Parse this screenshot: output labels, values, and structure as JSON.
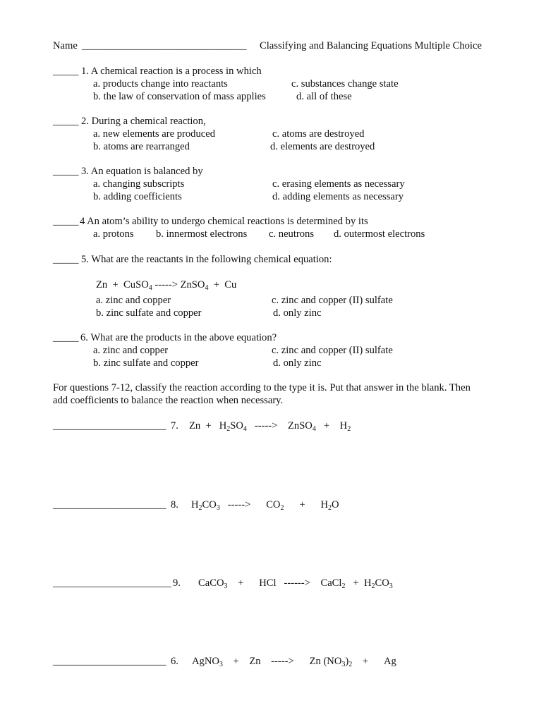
{
  "header": {
    "name_label": "Name",
    "name_blank": "________________________________",
    "title": "Classifying and Balancing Equations Multiple Choice"
  },
  "questions": [
    {
      "blank": "_____",
      "stem": "1.  A chemical reaction is a process in which",
      "a": "a.  products change into reactants",
      "b": "b.  the law of conservation of mass applies",
      "c": "c.  substances change state",
      "d": "d.  all of these"
    },
    {
      "blank": "_____",
      "stem": "2.  During a chemical reaction,",
      "a": "a.  new elements are produced",
      "b": "b.  atoms are rearranged",
      "c": "c.  atoms are destroyed",
      "d": "d.  elements are destroyed"
    },
    {
      "blank": "_____",
      "stem": "3.  An equation is balanced by",
      "a": "a.  changing subscripts",
      "b": "b.  adding coefficients",
      "c": "c.  erasing elements as necessary",
      "d": "d.  adding elements as necessary"
    },
    {
      "blank": "_____",
      "stem": "4  An atom’s ability to undergo chemical reactions is determined by its",
      "a": "a.  protons",
      "b": "b.  innermost electrons",
      "c": "c.  neutrons",
      "d": "d.  outermost electrons"
    },
    {
      "blank": "_____",
      "stem": "5.  What are the reactants in the following chemical equation:",
      "equation": {
        "r1": "Zn",
        "plus1": "+",
        "r2": "CuSO",
        "r2_sub": "4",
        "arrow": "----->",
        "p1": "ZnSO",
        "p1_sub": "4",
        "plus2": "+",
        "p2": "Cu"
      },
      "a": "a.  zinc and copper",
      "b": "b.  zinc sulfate and copper",
      "c": "c.  zinc and copper (II) sulfate",
      "d": "d.  only zinc"
    },
    {
      "blank": "_____",
      "stem": "6.  What are the products in the above equation?",
      "a": "a.  zinc and copper",
      "b": "b.  zinc sulfate and copper",
      "c": "c.  zinc and copper (II) sulfate",
      "d": "d.  only zinc"
    }
  ],
  "instructions": {
    "line1": "For questions 7-12,  classify the reaction according to the type it is. Put that answer in the blank.  Then",
    "line2": "add coefficients to balance the reaction when necessary."
  },
  "reactions": [
    {
      "blank": "______________________",
      "number": "7.",
      "parts": {
        "t1": "Zn",
        "plus1": "+",
        "t2a": "H",
        "t2a_sub": "2",
        "t2b": "SO",
        "t2b_sub": "4",
        "arrow": "----->",
        "t3": "ZnSO",
        "t3_sub": "4",
        "plus2": "+",
        "t4": "H",
        "t4_sub": "2"
      }
    },
    {
      "blank": "______________________",
      "number": "8.",
      "parts": {
        "t1a": "H",
        "t1a_sub": "2",
        "t1b": "CO",
        "t1b_sub": "3",
        "arrow": "----->",
        "t2": "CO",
        "t2_sub": "2",
        "plus1": "+",
        "t3a": "H",
        "t3a_sub": "2",
        "t3b": "O"
      }
    },
    {
      "blank": "_______________________",
      "number": "9.",
      "parts": {
        "t1": "CaCO",
        "t1_sub": "3",
        "plus1": "+",
        "t2": "HCl",
        "arrow": "------>",
        "t3": "CaCl",
        "t3_sub": "2",
        "plus2": "+",
        "t4a": "H",
        "t4a_sub": "2",
        "t4b": "CO",
        "t4b_sub": "3"
      }
    },
    {
      "blank": "______________________",
      "number": "6.",
      "parts": {
        "t1": "AgNO",
        "t1_sub": "3",
        "plus1": "+",
        "t2": "Zn",
        "arrow": "----->",
        "t3a": "Zn (NO",
        "t3a_sub": "3",
        "t3b": ")",
        "t3b_sub": "2",
        "plus2": "+",
        "t4": "Ag"
      }
    }
  ]
}
